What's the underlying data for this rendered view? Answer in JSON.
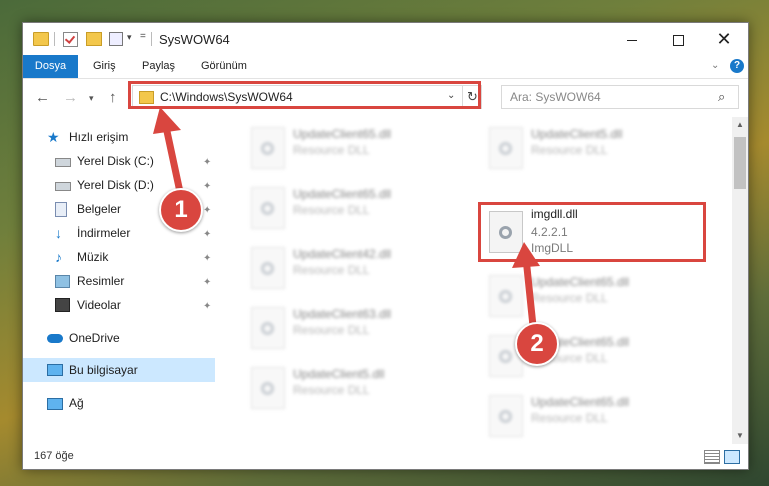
{
  "window": {
    "title": "SysWOW64"
  },
  "ribbon": {
    "tabs": [
      {
        "label": "Dosya"
      },
      {
        "label": "Giriş"
      },
      {
        "label": "Paylaş"
      },
      {
        "label": "Görünüm"
      }
    ]
  },
  "address": {
    "path": "C:\\Windows\\SysWOW64",
    "search_placeholder": "Ara: SysWOW64"
  },
  "sidebar": {
    "items": [
      {
        "label": "Hızlı erişim",
        "icon": "star-icon"
      },
      {
        "label": "Yerel Disk (C:)",
        "icon": "disk-icon"
      },
      {
        "label": "Yerel Disk (D:)",
        "icon": "disk-icon"
      },
      {
        "label": "Belgeler",
        "icon": "document-icon"
      },
      {
        "label": "İndirmeler",
        "icon": "download-icon"
      },
      {
        "label": "Müzik",
        "icon": "music-icon"
      },
      {
        "label": "Resimler",
        "icon": "pictures-icon"
      },
      {
        "label": "Videolar",
        "icon": "video-icon"
      },
      {
        "label": "OneDrive",
        "icon": "onedrive-icon"
      },
      {
        "label": "Bu bilgisayar",
        "icon": "computer-icon"
      },
      {
        "label": "Ağ",
        "icon": "network-icon"
      }
    ]
  },
  "files": {
    "left": [
      {
        "name": "UpdateClient65.dll",
        "sub": "Resource DLL"
      },
      {
        "name": "UpdateClient65.dll",
        "sub": "Resource DLL"
      },
      {
        "name": "UpdateClient42.dll",
        "sub": "Resource DLL"
      },
      {
        "name": "UpdateClient63.dll",
        "sub": "Resource DLL"
      },
      {
        "name": "UpdateClient5.dll",
        "sub": "Resource DLL"
      }
    ],
    "right": [
      {
        "name": "UpdateClient5.dll",
        "sub": "Resource DLL"
      },
      {
        "name": "UpdateClient65.dll",
        "sub": "Resource DLL"
      },
      {
        "name": "UpdateClient65.dll",
        "sub": "Resource DLL"
      },
      {
        "name": "UpdateClient65.dll",
        "sub": "Resource DLL"
      }
    ],
    "selected": {
      "name": "imgdll.dll",
      "version": "4.2.2.1",
      "description": "ImgDLL"
    }
  },
  "status": {
    "count": "167 öğe"
  },
  "annotations": {
    "step1": "1",
    "step2": "2",
    "color": "#d9463f"
  }
}
